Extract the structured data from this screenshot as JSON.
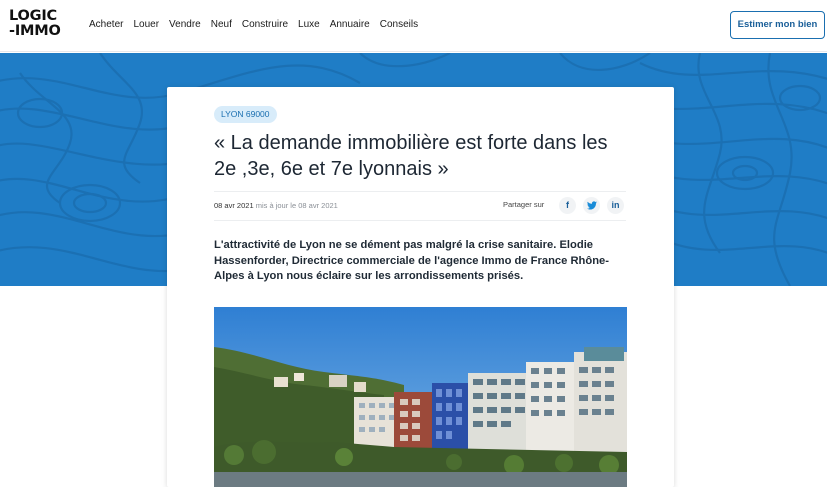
{
  "header": {
    "logo": {
      "line1": "LOGIC",
      "line2": "-IMMO"
    },
    "nav": [
      "Acheter",
      "Louer",
      "Vendre",
      "Neuf",
      "Construire",
      "Luxe",
      "Annuaire",
      "Conseils"
    ],
    "estimate_label": "Estimer mon bien"
  },
  "article": {
    "tag": "LYON 69000",
    "title": "« La demande immobilière est forte dans les 2e ,3e, 6e et 7e lyonnais »",
    "date": "08 avr 2021",
    "updated": "mis à jour le 08 avr 2021",
    "share_label": "Partager sur",
    "share": [
      {
        "name": "facebook",
        "glyph": "f"
      },
      {
        "name": "twitter",
        "glyph": "t"
      },
      {
        "name": "linkedin",
        "glyph": "in"
      }
    ],
    "lead": "L'attractivité de Lyon ne se dément pas malgré la crise sanitaire. Elodie Hassenforder, Directrice commerciale de l'agence Immo de France Rhône-Alpes à Lyon nous éclaire sur les arrondissements prisés."
  },
  "colors": {
    "hero_blue": "#1f7dc6",
    "accent": "#1a6fb0"
  }
}
